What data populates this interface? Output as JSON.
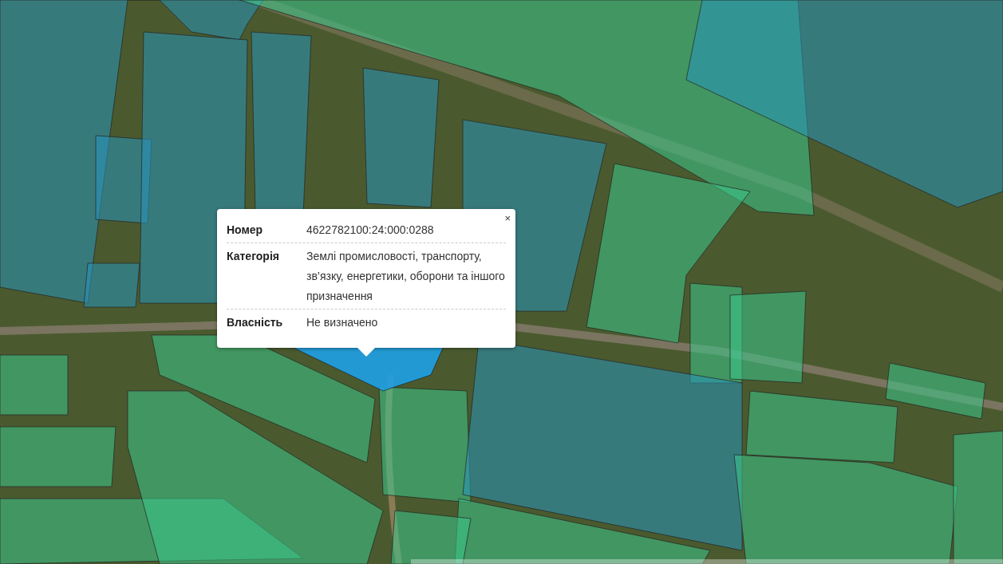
{
  "popup": {
    "close": "×",
    "fields": [
      {
        "label": "Номер",
        "value": "4622782100:24:000:0288"
      },
      {
        "label": "Категорія",
        "value": "Землі промисловості, транспорту, зв’язку, енергетики, оборони та іншого призначення"
      },
      {
        "label": "Власність",
        "value": "Не визначено"
      }
    ]
  }
}
